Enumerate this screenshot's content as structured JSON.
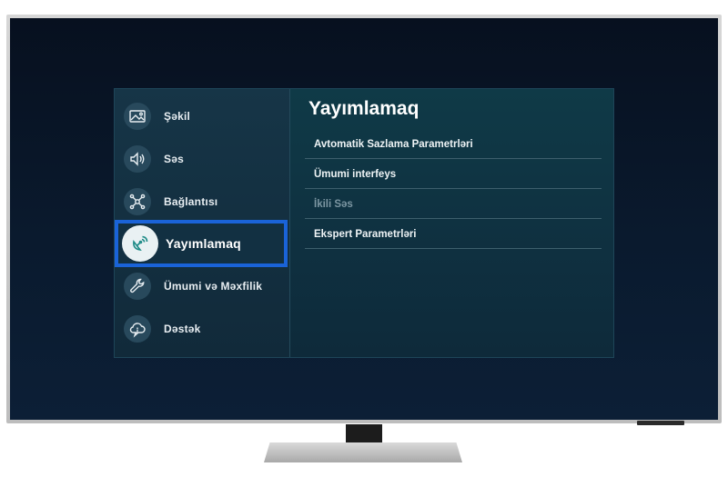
{
  "menu": {
    "items": [
      {
        "label": "Şəkil",
        "icon": "picture-icon"
      },
      {
        "label": "Səs",
        "icon": "speaker-icon"
      },
      {
        "label": "Bağlantısı",
        "icon": "connection-icon"
      },
      {
        "label": "Yayımlamaq",
        "icon": "broadcast-icon",
        "selected": true
      },
      {
        "label": "Ümumi və Məxfilik",
        "icon": "wrench-icon"
      },
      {
        "label": "Dəstək",
        "icon": "support-icon"
      }
    ]
  },
  "content": {
    "title": "Yayımlamaq",
    "options": [
      {
        "label": "Avtomatik Sazlama Parametrləri",
        "enabled": true
      },
      {
        "label": "Ümumi interfeys",
        "enabled": true
      },
      {
        "label": "İkili Səs",
        "enabled": false
      },
      {
        "label": "Ekspert Parametrləri",
        "enabled": true
      }
    ]
  },
  "colors": {
    "selection_border": "#1a63d8",
    "panel_bg": "#0f2a3a",
    "disabled_text": "#7c96a2"
  }
}
